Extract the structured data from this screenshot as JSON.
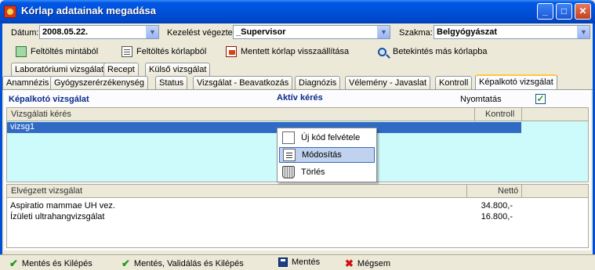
{
  "window": {
    "title": "Kórlap adatainak megadása",
    "minimize": "_",
    "maximize": "□",
    "close": "✕"
  },
  "fields": {
    "datum_label": "Dátum:",
    "datum_value": "2008.05.22.",
    "kezelest_label": "Kezelést végezte:",
    "kezelest_value": "_Supervisor",
    "szakma_label": "Szakma:",
    "szakma_value": "Belgyógyászat"
  },
  "toolbar": {
    "feltoltes_mintabol": "Feltöltés mintából",
    "feltoltes_korlapbol": "Feltöltés kórlapból",
    "mentett_visszaallitas": "Mentett kórlap visszaállítása",
    "betekintes": "Betekintés más kórlapba"
  },
  "tabs_row1": [
    "Laboratóriumi vizsgálat",
    "Recept",
    "Külső vizsgálat"
  ],
  "tabs_row2": [
    "Anamnézis",
    "Gyógyszerérzékenység",
    "Status",
    "Vizsgálat - Beavatkozás",
    "Diagnózis",
    "Vélemény - Javaslat",
    "Kontroll",
    "Képalkotó vizsgálat"
  ],
  "panel": {
    "section_title": "Képalkotó vizsgálat",
    "aktiv_keres": "Aktív kérés",
    "nyomtatas_label": "Nyomtatás",
    "nyomtatas_checked": "✓"
  },
  "grid_requests": {
    "col_request": "Vizsgálati kérés",
    "col_kontroll": "Kontroll",
    "rows": [
      "vizsg1"
    ]
  },
  "grid_done": {
    "col_done": "Elvégzett vizsgálat",
    "col_netto": "Nettó",
    "rows": [
      {
        "name": "Aspiratio mammae UH vez.",
        "netto": "34.800,-"
      },
      {
        "name": "Ízületi ultrahangvizsgálat",
        "netto": "16.800,-"
      }
    ]
  },
  "context_menu": {
    "items": [
      "Új kód felvétele",
      "Módosítás",
      "Törlés"
    ],
    "highlighted": "Módosítás"
  },
  "statusbar": {
    "mentes_kilepes": "Mentés és Kilépés",
    "mentes_validalas": "Mentés, Validálás és Kilépés",
    "mentes": "Mentés",
    "megsem": "Mégsem"
  },
  "colors": {
    "titlebar": "#0050d8",
    "selection": "#316ac5",
    "request_grid_bg": "#cdfafa",
    "section_title": "#0a2a8c"
  }
}
